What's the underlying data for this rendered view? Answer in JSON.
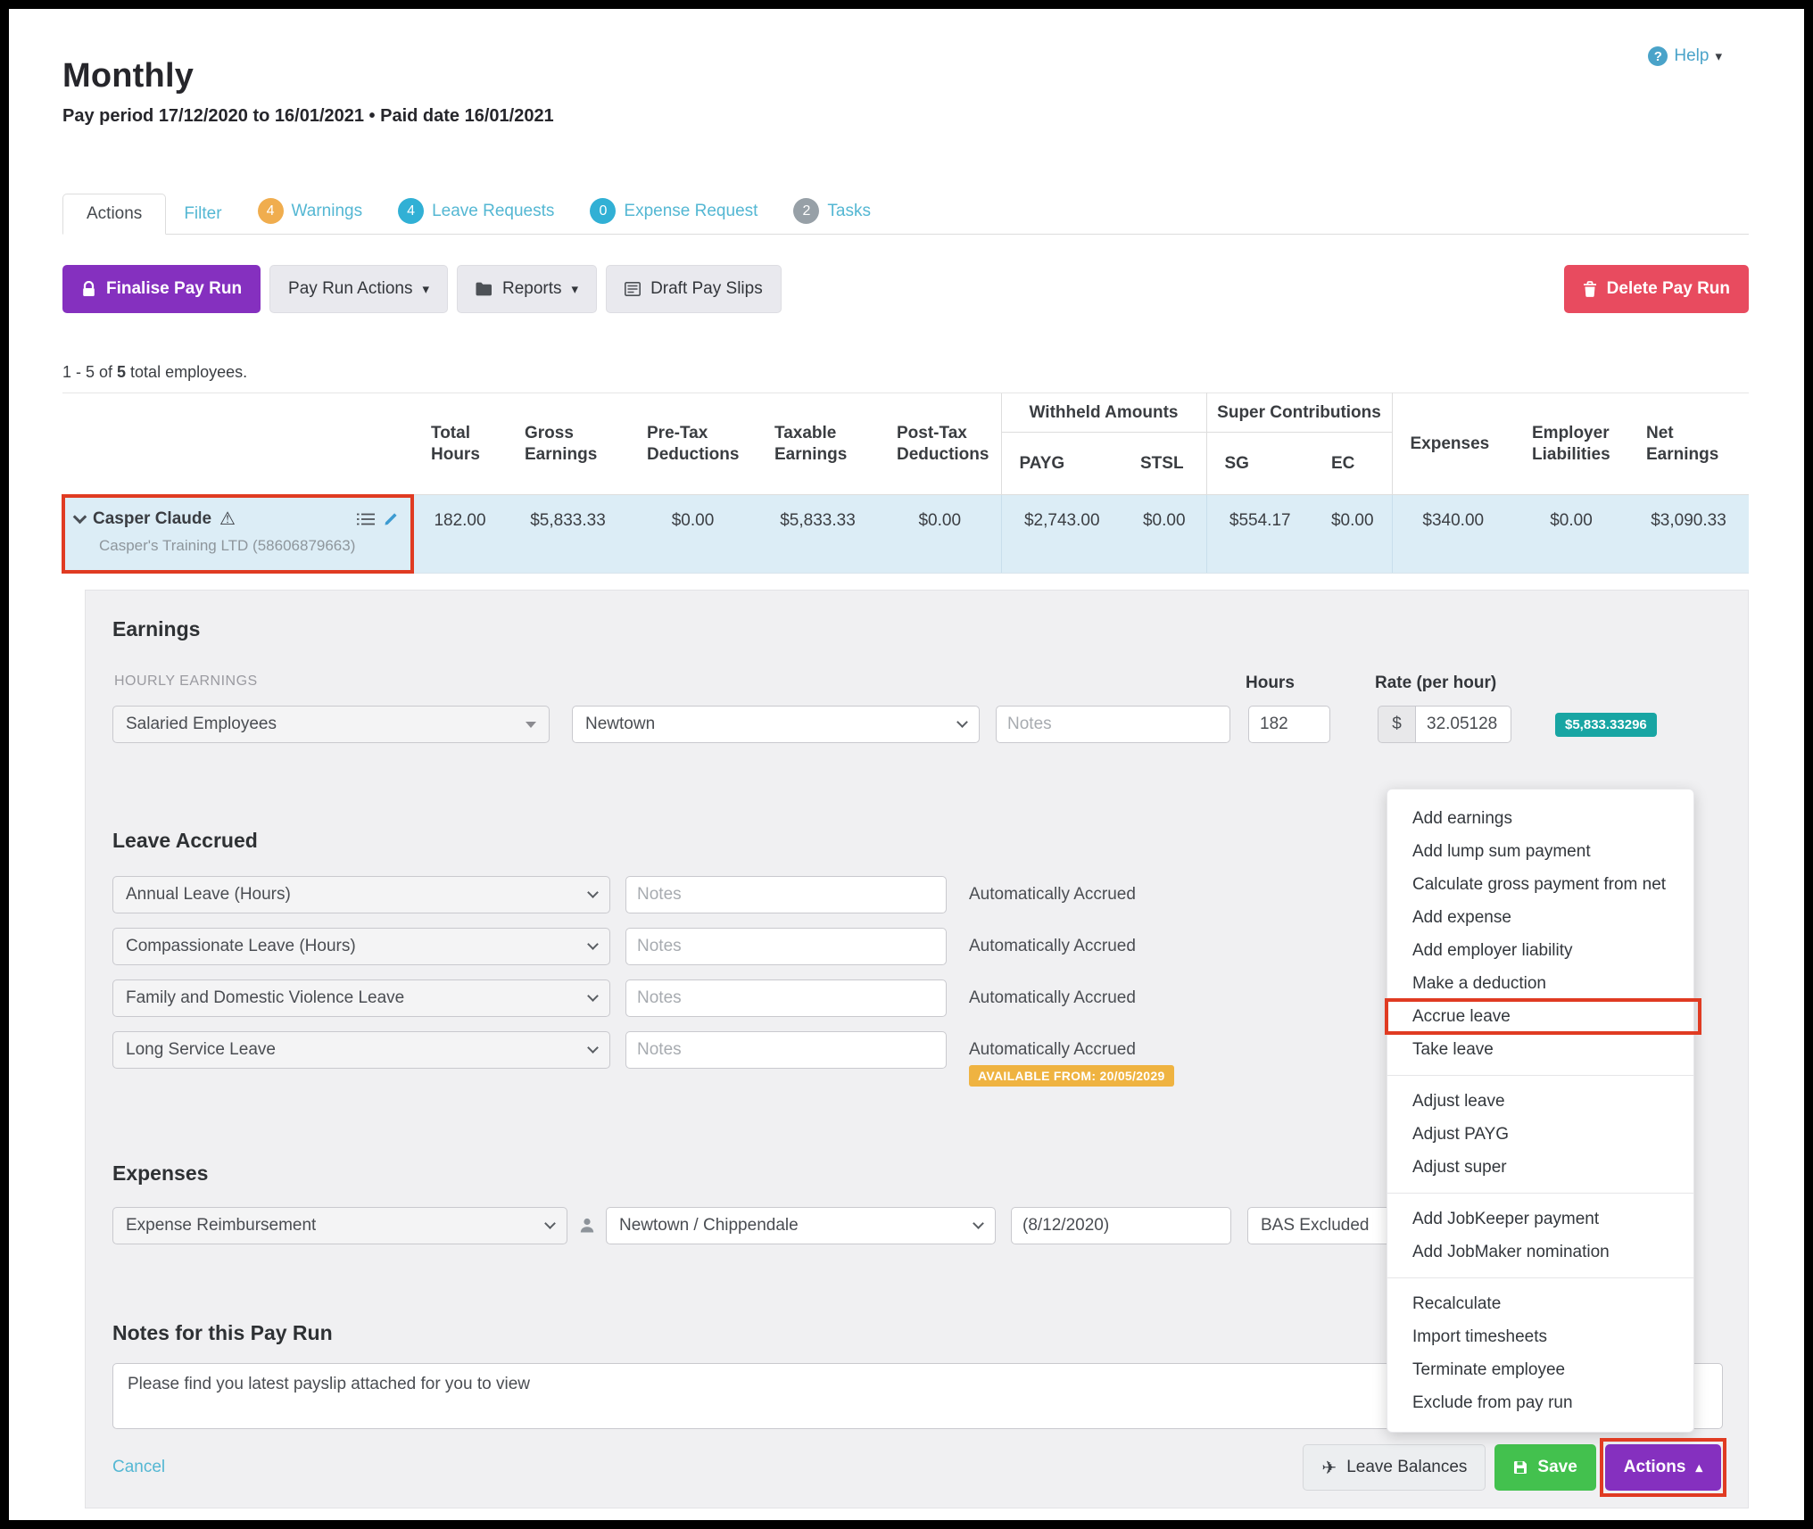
{
  "header": {
    "title": "Monthly",
    "subtitle": "Pay period 17/12/2020 to 16/01/2021 • Paid date 16/01/2021",
    "help_label": "Help"
  },
  "tabs": [
    {
      "label": "Actions"
    },
    {
      "label": "Filter"
    },
    {
      "label": "Warnings",
      "badge": "4"
    },
    {
      "label": "Leave Requests",
      "badge": "4"
    },
    {
      "label": "Expense Request",
      "badge": "0"
    },
    {
      "label": "Tasks",
      "badge": "2"
    }
  ],
  "toolbar": {
    "finalise": "Finalise Pay Run",
    "pay_run_actions": "Pay Run Actions",
    "reports": "Reports",
    "draft_pay_slips": "Draft Pay Slips",
    "delete": "Delete Pay Run"
  },
  "summary": {
    "prefix": "1 - 5 of ",
    "count": "5",
    "suffix": " total employees."
  },
  "table": {
    "group_headers": {
      "withheld": "Withheld Amounts",
      "super": "Super Contributions"
    },
    "columns": [
      "Total Hours",
      "Gross Earnings",
      "Pre-Tax Deductions",
      "Taxable Earnings",
      "Post-Tax Deductions",
      "PAYG",
      "STSL",
      "SG",
      "EC",
      "Expenses",
      "Employer Liabilities",
      "Net Earnings"
    ],
    "employee": {
      "name": "Casper Claude",
      "company": "Casper's Training LTD (58606879663)",
      "values": [
        "182.00",
        "$5,833.33",
        "$0.00",
        "$5,833.33",
        "$0.00",
        "$2,743.00",
        "$0.00",
        "$554.17",
        "$0.00",
        "$340.00",
        "$0.00",
        "$3,090.33"
      ]
    }
  },
  "earnings": {
    "heading": "Earnings",
    "sub_heading": "HOURLY EARNINGS",
    "hours_label": "Hours",
    "rate_label": "Rate (per hour)",
    "pay_category": "Salaried Employees",
    "location": "Newtown",
    "notes_placeholder": "Notes",
    "hours_value": "182",
    "currency_symbol": "$",
    "rate_value": "32.05128",
    "total_badge": "$5,833.33296"
  },
  "leave": {
    "heading": "Leave Accrued",
    "rows": [
      {
        "type": "Annual Leave (Hours)",
        "notes_placeholder": "Notes",
        "status": "Automatically Accrued"
      },
      {
        "type": "Compassionate Leave (Hours)",
        "notes_placeholder": "Notes",
        "status": "Automatically Accrued"
      },
      {
        "type": "Family and Domestic Violence Leave",
        "notes_placeholder": "Notes",
        "status": "Automatically Accrued"
      },
      {
        "type": "Long Service Leave",
        "notes_placeholder": "Notes",
        "status": "Automatically Accrued",
        "badge": "AVAILABLE FROM: 20/05/2029"
      }
    ]
  },
  "expenses": {
    "heading": "Expenses",
    "category": "Expense Reimbursement",
    "location": "Newtown / Chippendale",
    "date_value": "(8/12/2020)",
    "tax_code": "BAS Excluded"
  },
  "notes_section": {
    "heading": "Notes for this Pay Run",
    "value": "Please find you latest payslip attached for you to view"
  },
  "footer": {
    "cancel": "Cancel",
    "leave_balances": "Leave Balances",
    "save": "Save",
    "actions": "Actions"
  },
  "actions_menu": {
    "highlighted_item": "Accrue leave",
    "groups": [
      {
        "items": [
          "Add earnings",
          "Add lump sum payment",
          "Calculate gross payment from net",
          "Add expense",
          "Add employer liability",
          "Make a deduction",
          "Accrue leave",
          "Take leave"
        ]
      },
      {
        "items": [
          "Adjust leave",
          "Adjust PAYG",
          "Adjust super"
        ]
      },
      {
        "items": [
          "Add JobKeeper payment",
          "Add JobMaker nomination"
        ]
      },
      {
        "items": [
          "Recalculate",
          "Import timesheets",
          "Terminate employee",
          "Exclude from pay run"
        ]
      }
    ]
  },
  "colors": {
    "primary_purple": "#8530bf",
    "delete_red": "#e84b5f",
    "save_green": "#43c14e",
    "accent_teal": "#18a5a3",
    "warning_orange": "#f0ad4e",
    "info_blue": "#31b0d5",
    "annotation_red": "#e03b22",
    "row_highlight": "#dcedf6"
  }
}
